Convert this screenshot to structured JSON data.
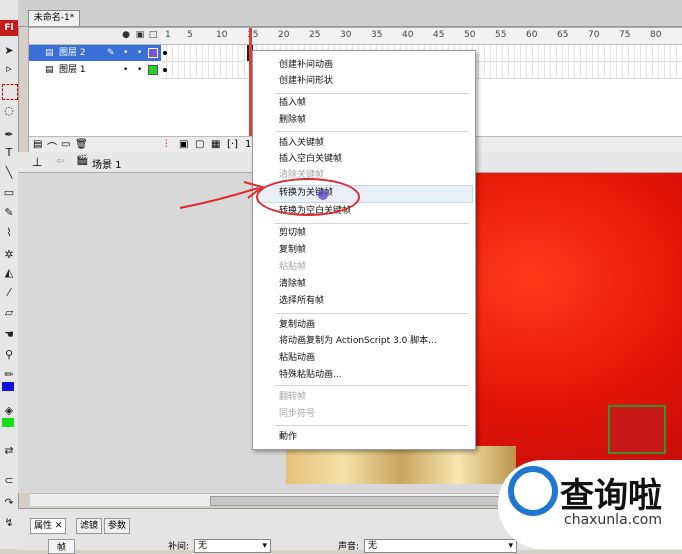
{
  "document_tab": "未命名-1*",
  "app_logo": "Fl",
  "timeline": {
    "ruler_ticks": [
      "1",
      "5",
      "10",
      "15",
      "20",
      "25",
      "30",
      "35",
      "40",
      "45",
      "50",
      "55",
      "60",
      "65",
      "70",
      "75",
      "80"
    ],
    "layers": [
      {
        "name": "图层 2",
        "color": "#7b4fe0",
        "selected": true
      },
      {
        "name": "图层 1",
        "color": "#2bcf2b",
        "selected": false
      }
    ],
    "current_frame": "1"
  },
  "scene": {
    "label": "场景 1"
  },
  "context_menu": {
    "items": [
      {
        "label": "创建补间动画",
        "disabled": false
      },
      {
        "label": "创建补间形状",
        "disabled": false
      },
      {
        "separator": true
      },
      {
        "label": "插入帧",
        "disabled": false
      },
      {
        "label": "删除帧",
        "disabled": false
      },
      {
        "separator": true
      },
      {
        "label": "插入关键帧",
        "disabled": false
      },
      {
        "label": "插入空白关键帧",
        "disabled": false
      },
      {
        "label": "清除关键帧",
        "disabled": true
      },
      {
        "label": "转换为关键帧",
        "disabled": false,
        "highlighted": true
      },
      {
        "label": "转换为空白关键帧",
        "disabled": false
      },
      {
        "separator": true
      },
      {
        "label": "剪切帧",
        "disabled": false
      },
      {
        "label": "复制帧",
        "disabled": false
      },
      {
        "label": "粘贴帧",
        "disabled": true
      },
      {
        "label": "清除帧",
        "disabled": false
      },
      {
        "label": "选择所有帧",
        "disabled": false
      },
      {
        "separator": true
      },
      {
        "label": "复制动画",
        "disabled": false
      },
      {
        "label": "将动画复制为 ActionScript 3.0 脚本...",
        "disabled": false
      },
      {
        "label": "粘贴动画",
        "disabled": false
      },
      {
        "label": "特殊粘贴动画...",
        "disabled": false
      },
      {
        "separator": true
      },
      {
        "label": "翻转帧",
        "disabled": true
      },
      {
        "label": "同步符号",
        "disabled": true
      },
      {
        "separator": true
      },
      {
        "label": "動作",
        "disabled": false
      }
    ]
  },
  "properties": {
    "tabs": [
      "属性",
      "滤镜",
      "参数"
    ],
    "frame_label": "帧",
    "tween_label": "补间:",
    "tween_value": "无",
    "sound_label": "声音:",
    "sound_value": "无"
  },
  "watermark": {
    "text_cn": "查询啦",
    "text_en": "chaxunla.com"
  },
  "colors": {
    "menu_highlight": "#e9eef8",
    "annotation": "#e0282a",
    "canvas_red": "#e41508"
  }
}
